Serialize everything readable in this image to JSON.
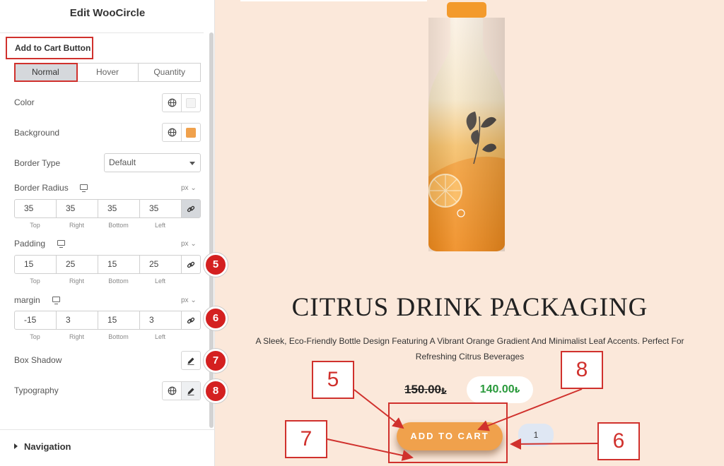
{
  "panel": {
    "title": "Edit WooCircle",
    "section_heading": "Add to Cart Button",
    "state_tabs": [
      "Normal",
      "Hover",
      "Quantity"
    ],
    "color": {
      "label": "Color",
      "swatch": "#f4f4f4"
    },
    "background": {
      "label": "Background",
      "swatch": "#f0a14c"
    },
    "border_type": {
      "label": "Border Type",
      "value": "Default"
    },
    "border_radius": {
      "label": "Border Radius",
      "unit": "px",
      "values": [
        "35",
        "35",
        "35",
        "35"
      ]
    },
    "padding": {
      "label": "Padding",
      "unit": "px",
      "values": [
        "15",
        "25",
        "15",
        "25"
      ]
    },
    "margin": {
      "label": "margin",
      "unit": "px",
      "values": [
        "-15",
        "3",
        "15",
        "3"
      ]
    },
    "dim_labels": [
      "Top",
      "Right",
      "Bottom",
      "Left"
    ],
    "box_shadow": {
      "label": "Box Shadow"
    },
    "typography": {
      "label": "Typography"
    },
    "navigation": {
      "label": "Navigation"
    },
    "badges": [
      "5",
      "6",
      "7",
      "8"
    ]
  },
  "product": {
    "title": "CITRUS DRINK PACKAGING",
    "description": "A Sleek, Eco-Friendly Bottle Design Featuring A Vibrant Orange Gradient And Minimalist Leaf Accents. Perfect For Refreshing Citrus Beverages",
    "old_price": "150.00",
    "new_price": "140.00",
    "currency_symbol": "₺",
    "add_to_cart_label": "ADD TO CART",
    "quantity": "1"
  },
  "callouts": [
    "5",
    "8",
    "7",
    "6"
  ],
  "colors": {
    "accent_red": "#d0312d",
    "button_orange": "#f0a14c",
    "price_green": "#2a9a3c",
    "preview_bg": "#fbe8da"
  }
}
